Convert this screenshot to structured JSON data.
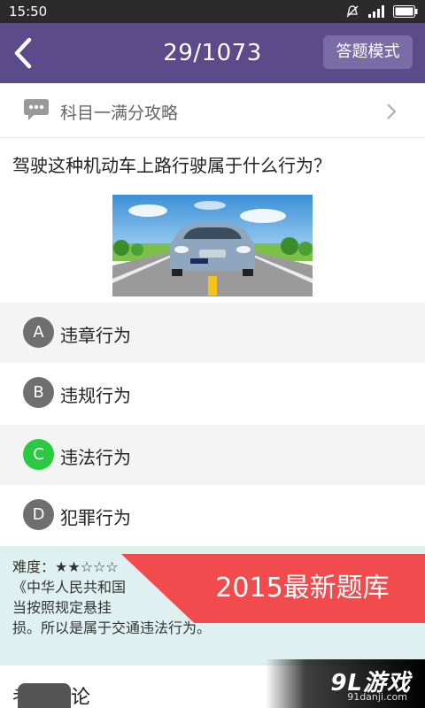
{
  "status_bar": {
    "time": "15:50"
  },
  "header": {
    "progress": "29/1073",
    "mode_button": "答题模式"
  },
  "tip": {
    "label": "科目一满分攻略"
  },
  "question": {
    "text": "驾驶这种机动车上路行驶属于什么行为？",
    "options": [
      {
        "letter": "A",
        "text": "违章行为"
      },
      {
        "letter": "B",
        "text": "违规行为"
      },
      {
        "letter": "C",
        "text": "违法行为"
      },
      {
        "letter": "D",
        "text": "犯罪行为"
      }
    ],
    "correct_option": "C"
  },
  "explanation": {
    "difficulty_label": "难度：",
    "difficulty_stars": "★★☆☆☆",
    "line1": "《中华人民共和国",
    "line2": "当按照规定悬挂",
    "line3": "损。所以是属于交通违法行为。"
  },
  "promo_banner": "2015最新题库",
  "comments": {
    "title": "考友评论"
  },
  "watermark": {
    "brand": "9L游戏",
    "url": "91danji.com"
  },
  "colors": {
    "app_bar": "#5b4b8a",
    "mode_button": "#7a6ca6",
    "option_default": "#6f6f6f",
    "option_correct": "#2bc940",
    "explanation_bg": "#dff0f0",
    "promo": "#f24b4e"
  }
}
